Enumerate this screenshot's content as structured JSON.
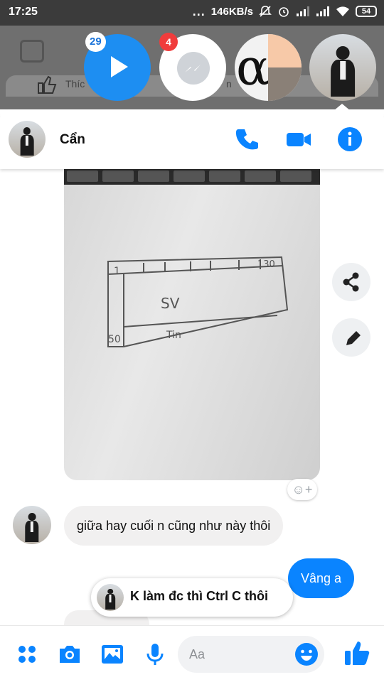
{
  "status_bar": {
    "time": "17:25",
    "dots": "...",
    "net_speed": "146KB/s",
    "battery": "54"
  },
  "chat_heads": [
    {
      "name": "video-head",
      "badge": "29"
    },
    {
      "name": "messenger-head",
      "badge": "4"
    },
    {
      "name": "alpha-head",
      "glyph": "α"
    },
    {
      "name": "active-contact-head"
    }
  ],
  "background_app": {
    "like_text": "Thíc",
    "comment_text": "n"
  },
  "chat": {
    "contact_name": "Cẩn",
    "messages": {
      "incoming_1": "giữa hay cuối n cũng như này thôi",
      "outgoing_1": "Vâng a",
      "partial": "... "
    },
    "photo_sketch": {
      "label_top_left": "1",
      "label_top_right": "130",
      "label_middle": "SV",
      "label_bottom_left": "50",
      "label_bottom": "Tin"
    },
    "preview_toast": "K làm đc thì Ctrl C thôi"
  },
  "composer": {
    "placeholder": "Aa"
  },
  "colors": {
    "accent": "#0a84ff",
    "badge_red": "#f03c3c",
    "status_bar": "#3b3b3b"
  }
}
